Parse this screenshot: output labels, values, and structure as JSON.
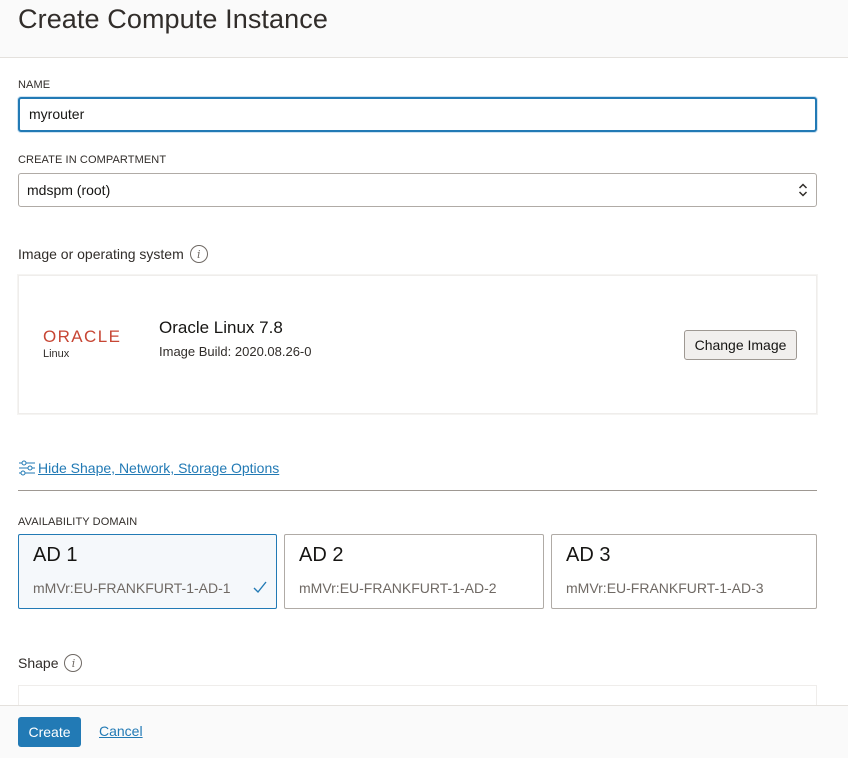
{
  "header": {
    "title": "Create Compute Instance"
  },
  "name_field": {
    "label": "NAME",
    "value": "myrouter"
  },
  "compartment": {
    "label": "CREATE IN COMPARTMENT",
    "value": "mdspm (root)"
  },
  "image_section": {
    "title": "Image or operating system",
    "logo_text": "ORACLE",
    "logo_subtext": "Linux",
    "os_name": "Oracle Linux 7.8",
    "build": "Image Build: 2020.08.26-0",
    "change_button": "Change Image"
  },
  "options_toggle": {
    "label": "Hide Shape, Network, Storage Options",
    "icon": "sliders-icon"
  },
  "availability": {
    "label": "AVAILABILITY DOMAIN",
    "domains": [
      {
        "title": "AD 1",
        "subtitle": "mMVr:EU-FRANKFURT-1-AD-1",
        "selected": true
      },
      {
        "title": "AD 2",
        "subtitle": "mMVr:EU-FRANKFURT-1-AD-2",
        "selected": false
      },
      {
        "title": "AD 3",
        "subtitle": "mMVr:EU-FRANKFURT-1-AD-3",
        "selected": false
      }
    ]
  },
  "shape_section": {
    "title": "Shape"
  },
  "footer": {
    "create_label": "Create",
    "cancel_label": "Cancel"
  },
  "colors": {
    "accent": "#227ab5",
    "oracle_red": "#c74634",
    "selected_bg": "#f5f8fb"
  }
}
